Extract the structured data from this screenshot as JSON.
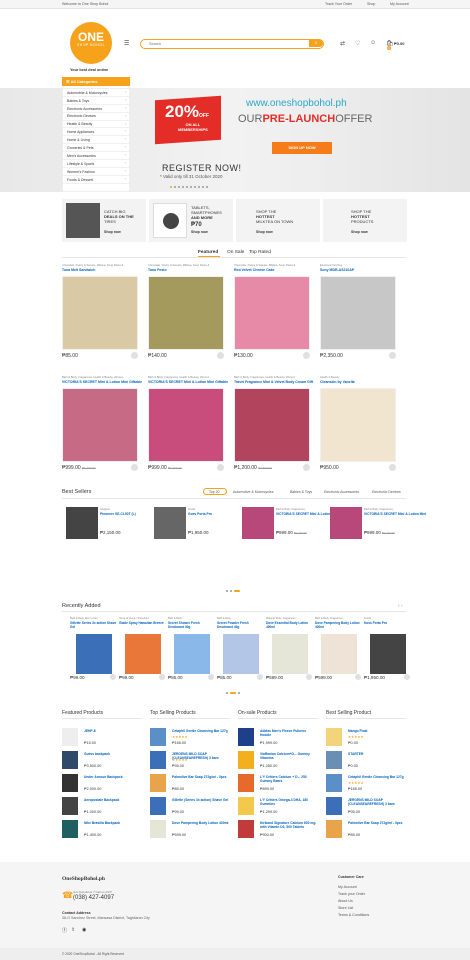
{
  "topbar": {
    "welcome": "Welcome to One Shop Bohol",
    "track": "Track Your Order",
    "shop": "Shop",
    "account": "My Account"
  },
  "logo": {
    "big": "ONE",
    "small": "SHOP BOHOL"
  },
  "tagline": "Your best deal online",
  "search": {
    "placeholder": "Search"
  },
  "cart": {
    "total": "₱0.00",
    "count": "0"
  },
  "categories": {
    "header": "All Categories",
    "items": [
      "Automobile & Motorcycles",
      "Babies & Toys",
      "Electronic Accessories",
      "Electronic Devices",
      "Health & Beauty",
      "Home Appliances",
      "Home & Living",
      "Groceries & Pets",
      "Men's Accessories",
      "Lifestyle & Sports",
      "Women's Fashion",
      "Foods & Dessert"
    ]
  },
  "banner": {
    "percent": "20%",
    "off": "OFF",
    "sub1": "ON ALL",
    "sub2": "MEMBERSHIPS",
    "url": "www.oneshopbohol.ph",
    "our": "OUR",
    "prelaunch": "PRE-LAUNCH",
    "offer": "OFFER",
    "signup": "SIGN UP NOW",
    "register": "REGISTER NOW!",
    "valid": "* Valid only till 31 October 2020"
  },
  "promos": [
    {
      "line1": "CATCH BIG",
      "line2": "DEALS ON THE",
      "line3": "TIRES",
      "shop": "Shop now"
    },
    {
      "line1": "TABLETS,",
      "line2": "SMARTPHONES",
      "line3": "AND MORE",
      "price": "₱70",
      "shop": "Shop now"
    },
    {
      "line1": "SHOP THE",
      "line2": "HOTTEST",
      "line3": "MILKTEA ON TOWN",
      "shop": "Shop now"
    },
    {
      "line1": "SHOP THE",
      "line2": "HOTTEST",
      "line3": "PRODUCTS",
      "shop": "Shop now"
    }
  ],
  "tabs": [
    "Featured",
    "On Sale",
    "Top Rated"
  ],
  "products": [
    {
      "cat": "Chocolate, Pastry & Sweets, Milktea, Soup Pasta &",
      "name": "Tuna Melt Sandwich",
      "price": "₱85.00",
      "old": "",
      "color": "#d9c9a4"
    },
    {
      "cat": "Chocolate, Pastry & Sweets, Milktea, Soup Pasta &",
      "name": "Tuna Pesto",
      "price": "₱140.00",
      "old": "",
      "color": "#a59a5d"
    },
    {
      "cat": "Chocolate, Pastry & Sweets, Milktea, Soup Pasta &",
      "name": "Red Velvet Cheese Cake",
      "price": "₱130.00",
      "old": "",
      "color": "#e78aa8"
    },
    {
      "cat": "Electronic Devices",
      "name": "Sony MDR-AS210AP",
      "price": "₱2,350.00",
      "old": "",
      "color": "#c7c7c7"
    },
    {
      "cat": "Bath & Body, Fragrances, Health & Beauty, Women",
      "name": "VICTORIA'S SECRET Mini & Lotion Mini Giftables Pure Seduction",
      "price": "₱999.00",
      "old": "₱1,200.00",
      "color": "#c76a86"
    },
    {
      "cat": "Bath & Body, Fragrances, Health & Beauty, Women",
      "name": "VICTORIA'S SECRET Mini & Lotion Mini Giftables Love Spell",
      "price": "₱999.00",
      "old": "₱1,200.00",
      "color": "#c84d7c"
    },
    {
      "cat": "Bath & Body, Fragrances, Health & Beauty, Women",
      "name": "Travel Fragrance Mini & Velvet Body Cream Gift Set Bombshell",
      "price": "₱1,200.00",
      "old": "₱1,500.00",
      "color": "#b3445d"
    },
    {
      "cat": "Health & Beauty",
      "name": "Cleanskin by Vanella",
      "price": "₱950.00",
      "old": "",
      "color": "#f1e5d0"
    }
  ],
  "bestsellers": {
    "title": "Best Sellers",
    "tabs": [
      "Top 20",
      "Automotive & Motorcycles",
      "Babies & Toys",
      "Electronic Accessories",
      "Electronic Devices"
    ],
    "items": [
      {
        "cat": "Gadgets",
        "name": "Pinoneer SE-CL50T (L)",
        "price": "₱2,150.00",
        "old": ""
      },
      {
        "cat": "Foods",
        "name": "Goes Porta Pro",
        "price": "₱1,950.00",
        "old": ""
      },
      {
        "cat": "Bath & Body, Fragrances,",
        "name": "VICTORIA'S SECRET Mini & Lotion Mini",
        "price": "₱999.00",
        "old": "₱1,200.00"
      },
      {
        "cat": "Bath & Body, Fragrances,",
        "name": "VICTORIA'S SECRET Mini & Lotion Mini",
        "price": "₱999.00",
        "old": "₱1,200.00"
      }
    ]
  },
  "recent": {
    "title": "Recently Added",
    "items": [
      {
        "cat": "Bath & Body, Men's Care",
        "name": "Gillette Series 3x action Shave Gel",
        "price": "₱99.00",
        "color": "#3b6fb8"
      },
      {
        "cat": "Home & Living, Household",
        "name": "Glade Spray Hawaiian Breeze",
        "price": "₱99.00",
        "color": "#e9773a"
      },
      {
        "cat": "Bath & Body",
        "name": "Secret Shower Fresh Deodorant 40g",
        "price": "₱85.00",
        "color": "#8ab8e8"
      },
      {
        "cat": "Bath & Body",
        "name": "Secret Powder Fresh Deodorant 40g",
        "price": "₱85.00",
        "color": "#b3c6e8"
      },
      {
        "cat": "Makeup Tools, Fragrances,",
        "name": "Dove Essential Body Lotion 400ml",
        "price": "₱599.00",
        "color": "#e6e6d8"
      },
      {
        "cat": "Bath & Body, Fragrances,",
        "name": "Dove Pampering Body Lotion 400ml",
        "price": "₱599.00",
        "color": "#efe3d8"
      },
      {
        "cat": "Foods",
        "name": "Koss Porta Pro",
        "price": "₱1,950.00",
        "color": "#444444"
      }
    ]
  },
  "columns": [
    {
      "title": "Featured Products",
      "items": [
        {
          "name": "JEHP-8",
          "price": "₱15.00",
          "stars": ""
        },
        {
          "name": "Guess backpack",
          "price": "₱3,500.00",
          "stars": ""
        },
        {
          "name": "Under Armour Backpack",
          "price": "₱2,000.00",
          "stars": ""
        },
        {
          "name": "Aeropostale Backpack",
          "price": "₱1,000.00",
          "stars": ""
        },
        {
          "name": "Nike Brasilia Backpack",
          "price": "₱1,400.00",
          "stars": ""
        }
      ]
    },
    {
      "title": "Top Selling Products",
      "items": [
        {
          "name": "Cetaphil Gentle Cleansing Bar 127g",
          "price": "₱165.00",
          "stars": "★★★★★"
        },
        {
          "name": "JERGENS MILD SOAP (CLEANSE&REFRESH) 3 bars",
          "price": "₱95.00",
          "stars": "★★★★★"
        },
        {
          "name": "Palmolive Bar Soap 272g/mi - 3pcs",
          "price": "₱85.00",
          "stars": ""
        },
        {
          "name": "Gillette (Series 3x action) Shave Gel",
          "price": "₱99.00",
          "stars": ""
        },
        {
          "name": "Dove Pampering Body Lotion 400ml",
          "price": "₱599.00",
          "stars": ""
        }
      ]
    },
    {
      "title": "On-sale Products",
      "items": [
        {
          "name": "Adidas Men's Fleece Pullover Hoodie",
          "price": "₱1,999.00",
          "stars": ""
        },
        {
          "name": "ViaRanian Calcium+D... Gummy Vitamins",
          "price": "₱1,250.00",
          "stars": ""
        },
        {
          "name": "L'Y Critters Calcium + D... 250 Gummy Bears",
          "price": "₱899.00",
          "stars": ""
        },
        {
          "name": "L'Y Critters Omega-3 DHA, 180 Gummies",
          "price": "₱1,299.00",
          "stars": ""
        },
        {
          "name": "Kirkland Signature Calcium 600 mg. with Vitamin D3, 500 Tablets",
          "price": "₱900.00",
          "stars": ""
        }
      ]
    },
    {
      "title": "Best Selling Product",
      "items": [
        {
          "name": "Mango Float",
          "price": "₱0.00",
          "stars": "★★★★★"
        },
        {
          "name": "STARTER",
          "price": "₱0.00",
          "stars": ""
        },
        {
          "name": "Cetaphil Gentle Cleansing Bar 127g",
          "price": "₱165.00",
          "stars": "★★★★★"
        },
        {
          "name": "JERGENS MILD SOAP (CLEANSE&REFRESH) 3 bars",
          "price": "₱95.00",
          "stars": ""
        },
        {
          "name": "Palmolive Bar Soap 272g/mi - 3pcs",
          "price": "₱85.00",
          "stars": ""
        }
      ]
    }
  ],
  "footer": {
    "brand": "OneShopBohol.ph",
    "question": "Got Questions ? Call us 24/7!",
    "phone": "(038) 427-4097",
    "contact_title": "Contact Address",
    "address": "38-G Sanchez Street, Mansasa District, Tagbilaran City",
    "care_title": "Customer Care",
    "care_links": [
      "My Account",
      "Track your Order",
      "About Us",
      "Store List",
      "Terms & Conditions"
    ],
    "copyright": "© 2020 OneShopBohol - All Right Reserved"
  },
  "colors": {
    "accent": "#f7a21b",
    "link": "#0062bd",
    "sale": "#e52d27"
  }
}
